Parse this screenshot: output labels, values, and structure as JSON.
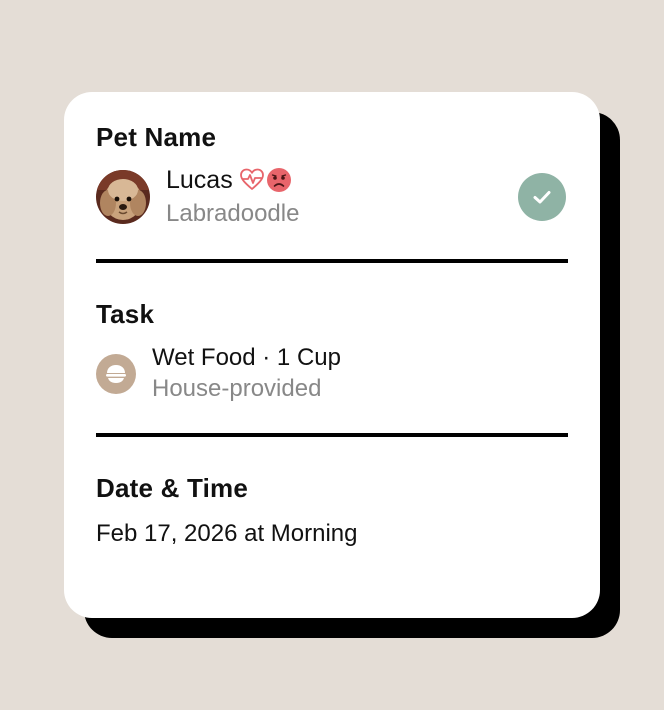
{
  "pet_section": {
    "title": "Pet Name",
    "name": "Lucas",
    "breed": "Labradoodle",
    "icons": [
      "heart-pulse-icon",
      "sad-face-icon",
      "check-icon"
    ]
  },
  "task_section": {
    "title": "Task",
    "task": "Wet Food · 1 Cup",
    "source": "House-provided",
    "icon": "food-bowl-icon"
  },
  "date_section": {
    "title": "Date & Time",
    "value": "Feb 17, 2026 at Morning"
  },
  "colors": {
    "background": "#e4ddd6",
    "card": "#ffffff",
    "check": "#8fb3a5",
    "bowl": "#c2aa94",
    "alert": "#e8656b"
  }
}
